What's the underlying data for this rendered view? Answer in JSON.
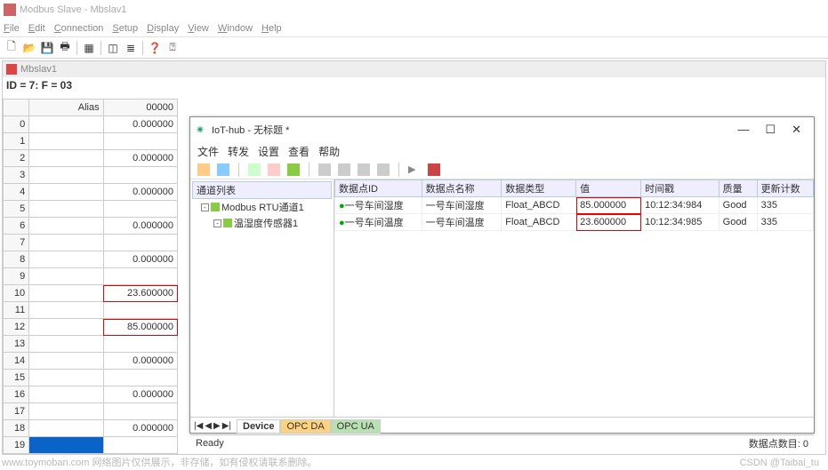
{
  "app": {
    "title": "Modbus Slave - Mbslav1",
    "menus": [
      "File",
      "Edit",
      "Connection",
      "Setup",
      "Display",
      "View",
      "Window",
      "Help"
    ]
  },
  "mdi": {
    "title": "Mbslav1",
    "idline": "ID = 7: F = 03",
    "headers": {
      "alias": "Alias",
      "value": "00000"
    },
    "rows": [
      {
        "n": "0",
        "v": "0.000000"
      },
      {
        "n": "1",
        "v": ""
      },
      {
        "n": "2",
        "v": "0.000000"
      },
      {
        "n": "3",
        "v": ""
      },
      {
        "n": "4",
        "v": "0.000000"
      },
      {
        "n": "5",
        "v": ""
      },
      {
        "n": "6",
        "v": "0.000000"
      },
      {
        "n": "7",
        "v": ""
      },
      {
        "n": "8",
        "v": "0.000000"
      },
      {
        "n": "9",
        "v": ""
      },
      {
        "n": "10",
        "v": "23.600000",
        "hl": true
      },
      {
        "n": "11",
        "v": ""
      },
      {
        "n": "12",
        "v": "85.000000",
        "hl": true
      },
      {
        "n": "13",
        "v": ""
      },
      {
        "n": "14",
        "v": "0.000000"
      },
      {
        "n": "15",
        "v": ""
      },
      {
        "n": "16",
        "v": "0.000000"
      },
      {
        "n": "17",
        "v": ""
      },
      {
        "n": "18",
        "v": "0.000000"
      },
      {
        "n": "19",
        "v": "",
        "sel": true
      }
    ]
  },
  "iot": {
    "title": "IoT-hub - 无标题 *",
    "menus": [
      "文件",
      "转发",
      "设置",
      "查看",
      "帮助"
    ],
    "win_controls": {
      "min": "—",
      "max": "☐",
      "close": "✕"
    },
    "tree": {
      "header": "通道列表",
      "item1": "Modbus RTU通道1",
      "item2": "温湿度传感器1"
    },
    "cols": {
      "id": "数据点ID",
      "name": "数据点名称",
      "type": "数据类型",
      "val": "值",
      "ts": "时间戳",
      "q": "质量",
      "cnt": "更新计数"
    },
    "rows": [
      {
        "id": "一号车间湿度",
        "name": "一号车间湿度",
        "type": "Float_ABCD",
        "val": "85.000000",
        "ts": "10:12:34:984",
        "q": "Good",
        "cnt": "335"
      },
      {
        "id": "一号车间温度",
        "name": "一号车间温度",
        "type": "Float_ABCD",
        "val": "23.600000",
        "ts": "10:12:34:985",
        "q": "Good",
        "cnt": "335"
      }
    ],
    "tabs": {
      "device": "Device",
      "opcda": "OPC DA",
      "opcua": "OPC UA"
    },
    "status_left": "Ready",
    "status_right": "数据点数目: 0"
  },
  "watermark": "www.toymoban.com  网络图片仅供展示，非存储，如有侵权请联系删除。",
  "watermark2": "CSDN @Taibai_tu"
}
